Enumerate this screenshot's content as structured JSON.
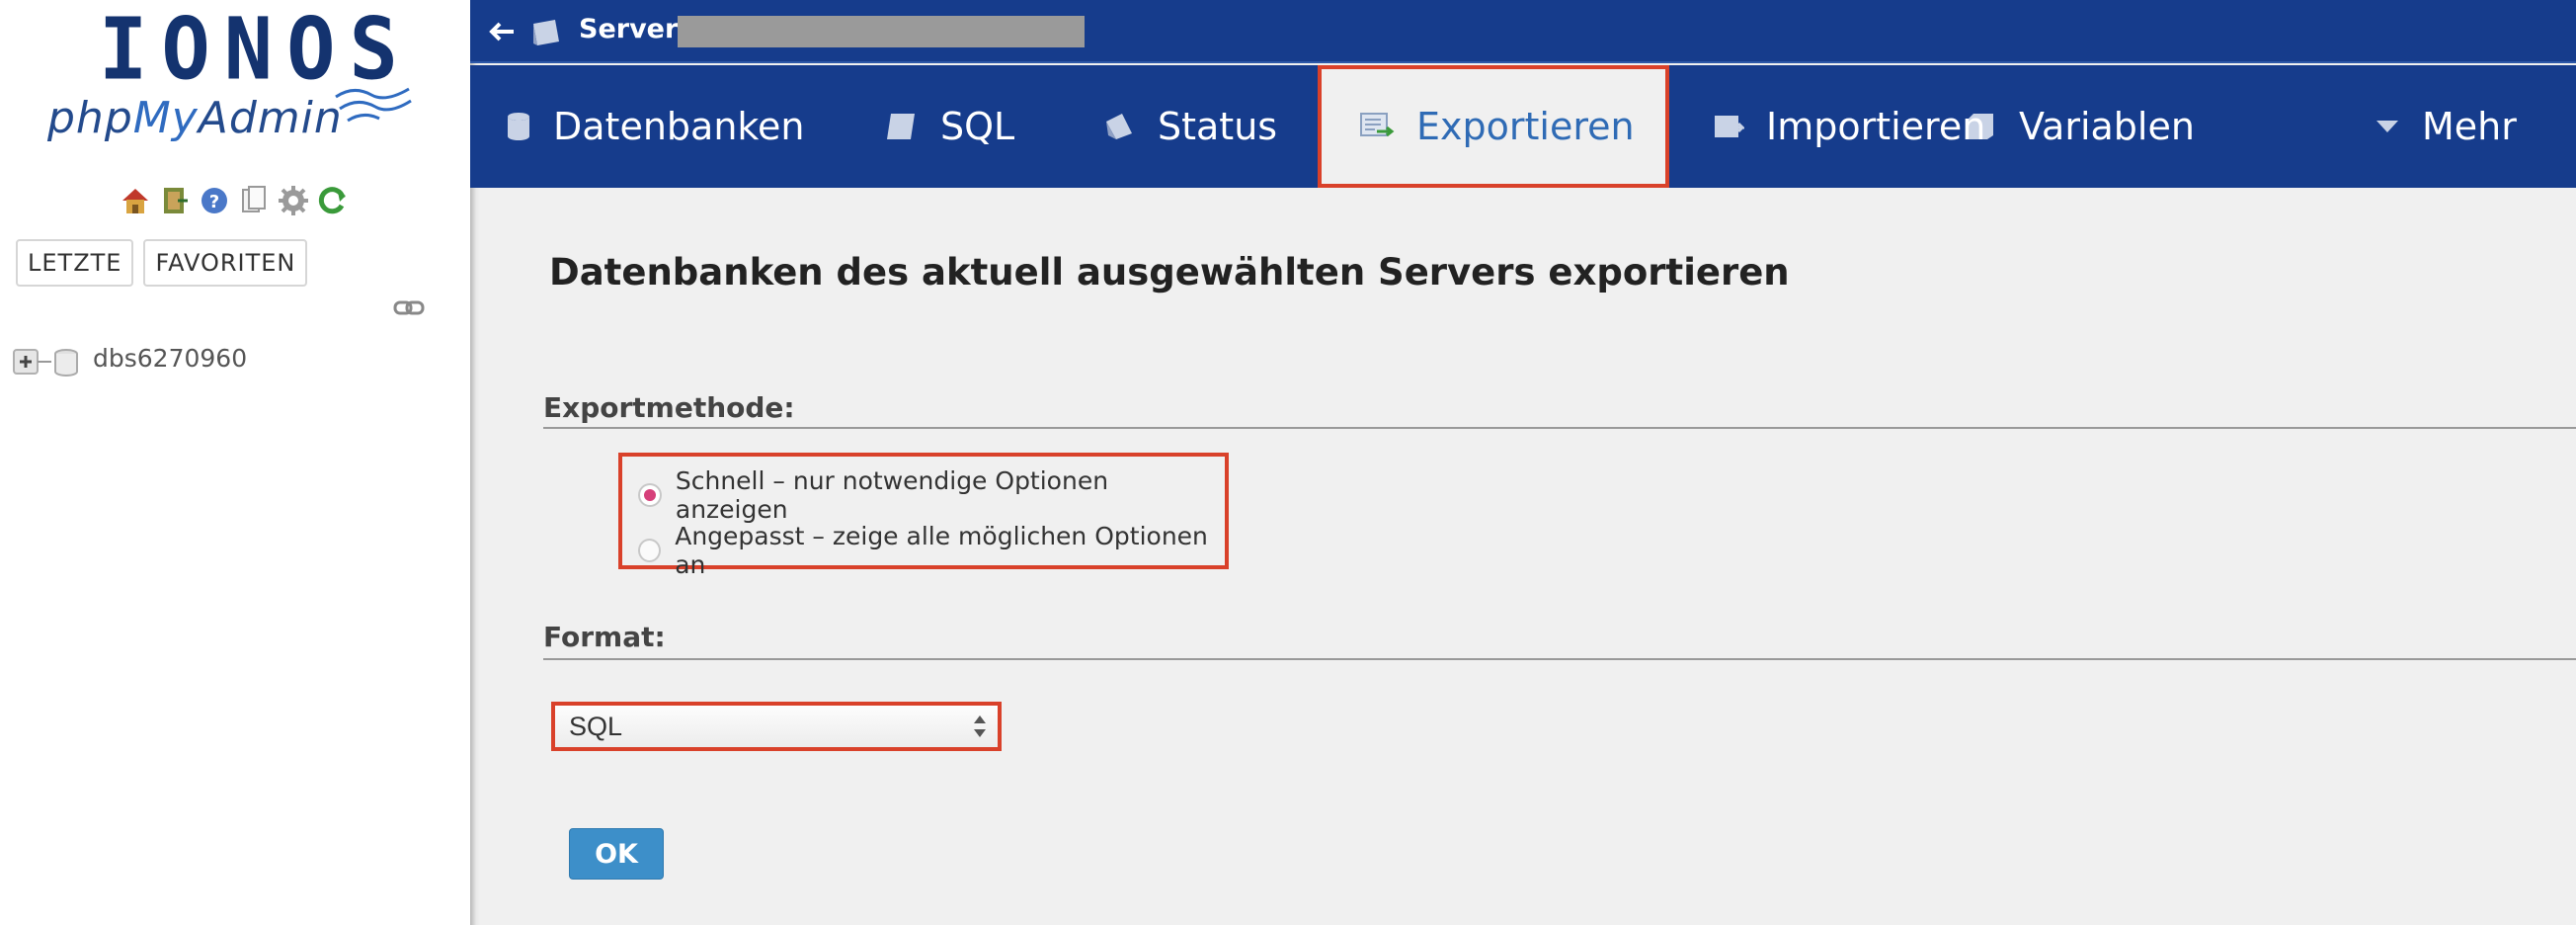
{
  "logo": {
    "brand": "IONOS",
    "product_prefix": "php",
    "product_my": "My",
    "product_suffix": "Admin"
  },
  "sidebar": {
    "nav_icons": [
      "home-icon",
      "logout-icon",
      "help-icon",
      "docs-icon",
      "settings-icon",
      "reload-icon"
    ],
    "tabs": [
      "LETZTE",
      "FAVORITEN"
    ],
    "database": "dbs6270960"
  },
  "serverbar": {
    "label": "Server:"
  },
  "tabs": [
    {
      "label": "Datenbanken",
      "icon": "database-icon"
    },
    {
      "label": "SQL",
      "icon": "sql-icon"
    },
    {
      "label": "Status",
      "icon": "status-icon"
    },
    {
      "label": "Exportieren",
      "icon": "export-icon",
      "active": true
    },
    {
      "label": "Importieren",
      "icon": "import-icon"
    },
    {
      "label": "Variablen",
      "icon": "variables-icon"
    },
    {
      "label": "Mehr",
      "icon": "chevron-down-icon"
    }
  ],
  "main": {
    "title": "Datenbanken des aktuell ausgewählten Servers exportieren",
    "method_title": "Exportmethode:",
    "method_options": [
      {
        "label": "Schnell – nur notwendige Optionen anzeigen",
        "checked": true
      },
      {
        "label": "Angepasst – zeige alle möglichen Optionen an",
        "checked": false
      }
    ],
    "format_title": "Format:",
    "format_value": "SQL",
    "ok_label": "OK"
  },
  "colors": {
    "brand_blue": "#163c8c",
    "highlight_red": "#d9412a",
    "active_tab_text": "#2f6bb5",
    "button_blue": "#3d8fc9"
  }
}
